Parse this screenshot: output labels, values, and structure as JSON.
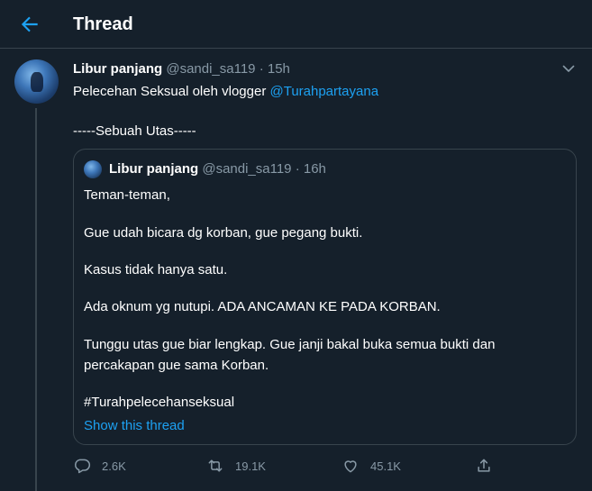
{
  "header": {
    "title": "Thread"
  },
  "tweet": {
    "name": "Libur panjang",
    "handle": "@sandi_sa119",
    "separator": "·",
    "time": "15h",
    "text_prefix": "Pelecehan Seksual oleh vlogger ",
    "mention": "@Turahpartayana",
    "text_line2": "-----Sebuah Utas-----"
  },
  "quote": {
    "name": "Libur panjang",
    "handle": "@sandi_sa119",
    "separator": "·",
    "time": "16h",
    "lines": [
      "Teman-teman,",
      "Gue udah  bicara dg korban, gue pegang bukti.",
      "Kasus tidak hanya satu.",
      "Ada oknum yg nutupi. ADA ANCAMAN KE PADA KORBAN.",
      "Tunggu utas gue biar lengkap. Gue janji bakal buka semua bukti dan",
      "percakapan gue sama Korban.",
      "#Turahpelecehanseksual"
    ],
    "show_thread": "Show this thread"
  },
  "actions": {
    "reply_count": "2.6K",
    "retweet_count": "19.1K",
    "like_count": "45.1K"
  },
  "colors": {
    "background": "#15202b",
    "accent": "#1da1f2",
    "muted": "#8899a6",
    "border": "#38444d"
  },
  "icons": [
    "back-arrow-icon",
    "chevron-down-icon",
    "reply-icon",
    "retweet-icon",
    "like-icon",
    "share-icon"
  ]
}
